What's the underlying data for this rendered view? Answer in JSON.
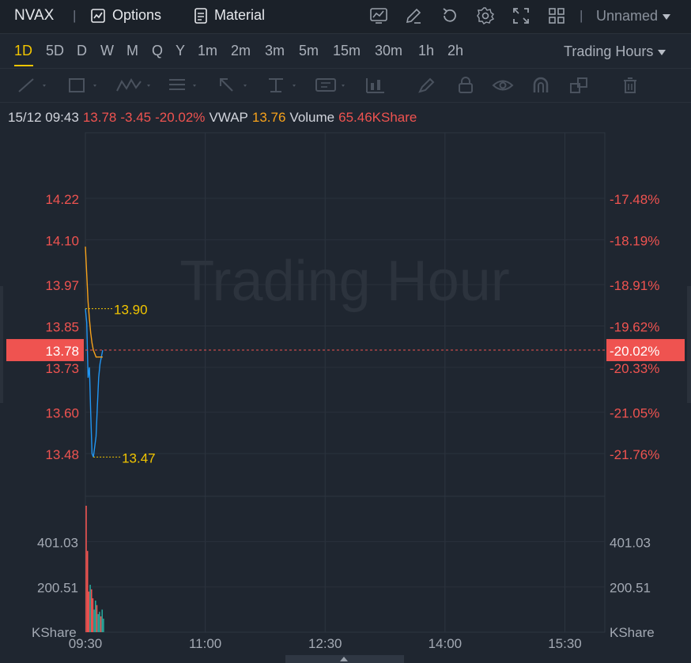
{
  "header": {
    "symbol": "NVAX",
    "options_label": "Options",
    "material_label": "Material",
    "layout_name": "Unnamed",
    "icons": [
      "chart-settings-icon",
      "edit-icon",
      "refresh-icon",
      "gear-icon",
      "fullscreen-icon",
      "grid-layout-icon"
    ]
  },
  "timeframes": {
    "items": [
      "1D",
      "5D",
      "D",
      "W",
      "M",
      "Q",
      "Y",
      "1m",
      "2m",
      "3m",
      "5m",
      "15m",
      "30m",
      "1h",
      "2h"
    ],
    "active": "1D",
    "session_label": "Trading Hours"
  },
  "drawing_tools": [
    "line-tool-icon",
    "rectangle-tool-icon",
    "pattern-tool-icon",
    "fib-tool-icon",
    "arrow-tool-icon",
    "measure-tool-icon",
    "text-tool-icon",
    "candle-tool-icon",
    "brush-icon",
    "lock-icon",
    "eye-icon",
    "magnet-icon",
    "layers-icon",
    "trash-icon"
  ],
  "quote": {
    "datetime": "15/12 09:43",
    "price": "13.78",
    "change": "-3.45",
    "change_pct": "-20.02%",
    "vwap_label": "VWAP",
    "vwap": "13.76",
    "volume_label": "Volume",
    "volume": "65.46KShare"
  },
  "colors": {
    "down": "#ef5350",
    "up": "#26a69a",
    "price_line": "#2196f3",
    "vwap_line": "#f7a21b",
    "marker": "#f2c500"
  },
  "chart_data": {
    "type": "line",
    "watermark": "Trading Hour",
    "price_axis": {
      "ticks": [
        14.22,
        14.1,
        13.97,
        13.85,
        13.73,
        13.6,
        13.48
      ],
      "tick_labels": [
        "14.22",
        "14.10",
        "13.97",
        "13.85",
        "13.73",
        "13.60",
        "13.48"
      ],
      "pct_labels": [
        "-17.48%",
        "-18.19%",
        "-18.91%",
        "-19.62%",
        "-20.33%",
        "-21.05%",
        "-21.76%"
      ],
      "current": "13.78",
      "current_pct": "-20.02%",
      "ylim": [
        13.4,
        14.3
      ]
    },
    "time_axis": {
      "ticks": [
        "09:30",
        "11:00",
        "12:30",
        "14:00",
        "15:30"
      ],
      "xlim_minutes": [
        0,
        390
      ]
    },
    "high_marker": "13.90",
    "low_marker": "13.47",
    "series": [
      {
        "kind": "price",
        "x": [
          0,
          1,
          2,
          3,
          4,
          5,
          6,
          7,
          8,
          9,
          10,
          11,
          12,
          13
        ],
        "y": [
          13.9,
          13.86,
          13.7,
          13.73,
          13.6,
          13.48,
          13.47,
          13.5,
          13.53,
          13.62,
          13.7,
          13.74,
          13.76,
          13.78
        ]
      },
      {
        "kind": "vwap",
        "x": [
          0,
          1,
          2,
          3,
          4,
          5,
          6,
          7,
          8,
          9,
          10,
          11,
          12,
          13
        ],
        "y": [
          14.08,
          14.0,
          13.92,
          13.87,
          13.83,
          13.8,
          13.78,
          13.77,
          13.76,
          13.76,
          13.76,
          13.76,
          13.76,
          13.76
        ]
      }
    ],
    "volume": {
      "axis_labels": [
        "401.03",
        "200.51"
      ],
      "unit": "KShare",
      "ticks": [
        401.03,
        200.51
      ],
      "ylim": [
        0,
        560
      ],
      "x": [
        0,
        1,
        2,
        3,
        4,
        5,
        6,
        7,
        8,
        9,
        10,
        11,
        12,
        13
      ],
      "values": [
        560,
        360,
        180,
        210,
        190,
        150,
        100,
        140,
        120,
        80,
        90,
        70,
        100,
        60
      ],
      "direction": [
        "down",
        "down",
        "down",
        "up",
        "down",
        "down",
        "up",
        "up",
        "down",
        "up",
        "up",
        "down",
        "up",
        "up"
      ]
    }
  }
}
